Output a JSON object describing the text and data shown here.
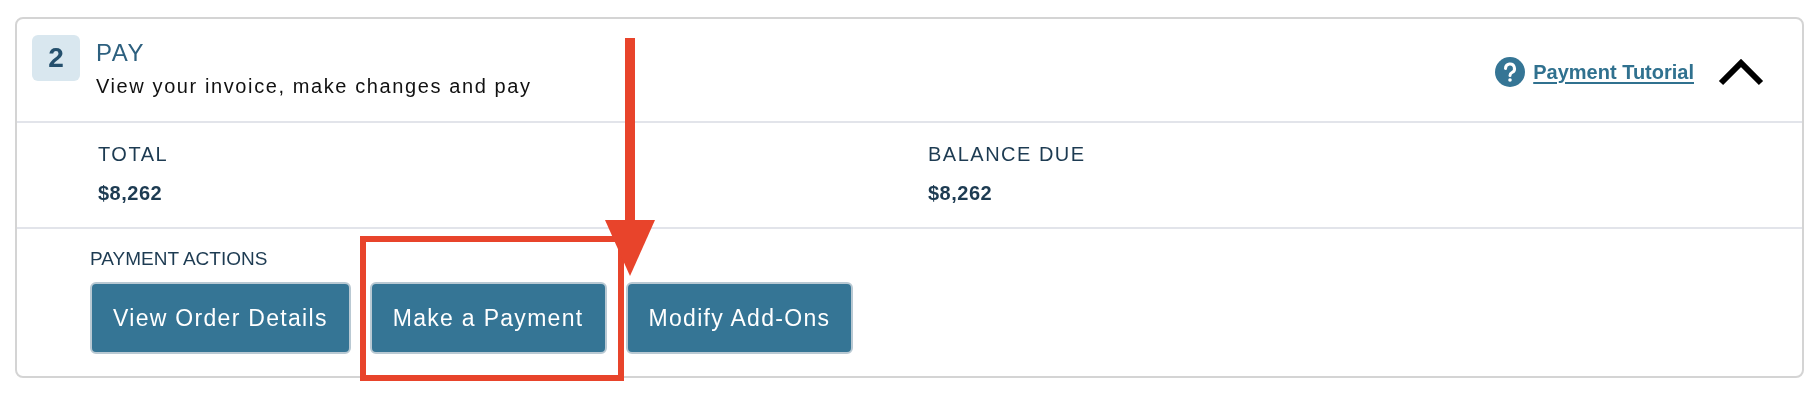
{
  "step": {
    "number": "2",
    "title": "PAY",
    "subtitle": "View your invoice, make changes and pay",
    "help_link": "Payment Tutorial",
    "expanded": true
  },
  "summary": [
    {
      "label": "TOTAL",
      "value": "$8,262"
    },
    {
      "label": "BALANCE DUE",
      "value": "$8,262"
    }
  ],
  "actions": {
    "label": "PAYMENT ACTIONS",
    "buttons": [
      {
        "label": "View Order Details",
        "highlighted": false
      },
      {
        "label": "Make a Payment",
        "highlighted": true
      },
      {
        "label": "Modify Add-Ons",
        "highlighted": false
      }
    ]
  }
}
